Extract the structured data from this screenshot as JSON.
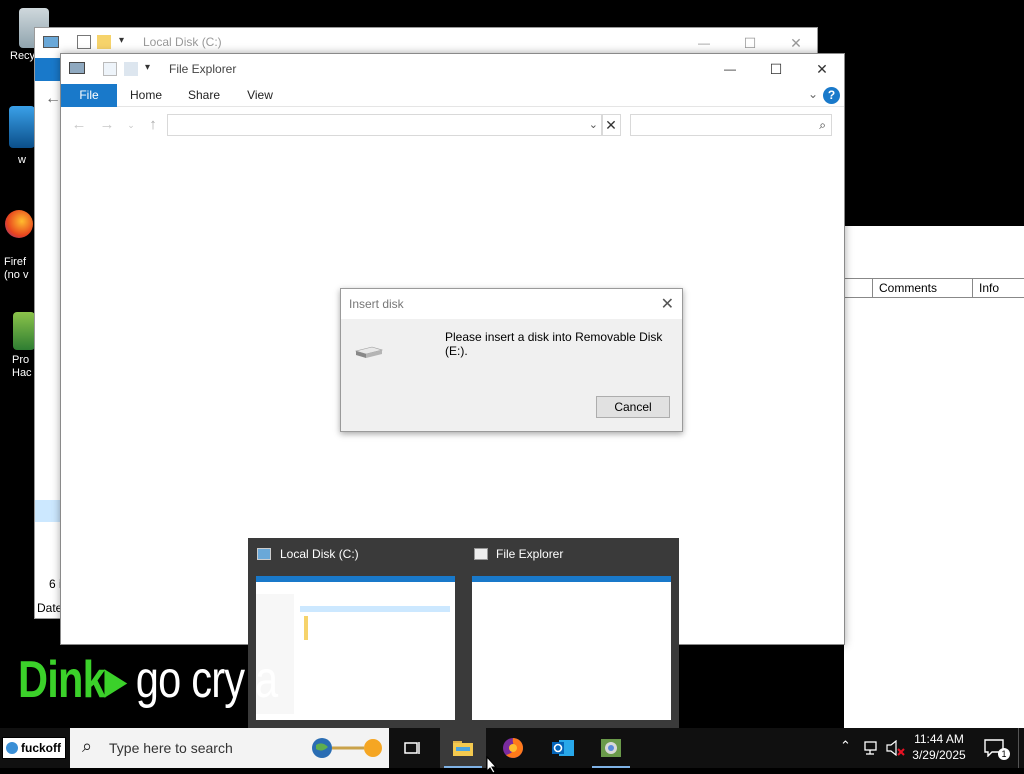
{
  "desktop": {
    "icons": [
      {
        "label": "Recy"
      },
      {
        "label": "w"
      },
      {
        "label": "Firef\n(no v"
      },
      {
        "label": "Pro\nHac"
      }
    ],
    "background_text": {
      "part1": "Dink",
      "arrow": "▸",
      "part2": " go cry a"
    }
  },
  "background_window": {
    "title": "Local Disk (C:)",
    "left_partial_labels": {
      "count": "6 i",
      "date": "Date"
    }
  },
  "background_right_table": {
    "columns": [
      "Comments",
      "Info"
    ]
  },
  "file_explorer": {
    "title": "File Explorer",
    "tabs": [
      "File",
      "Home",
      "Share",
      "View"
    ],
    "help_label": "?",
    "minimize_label": "—",
    "maximize_label": "☐",
    "close_label": "✕"
  },
  "dialog": {
    "title": "Insert disk",
    "message": "Please insert a disk into Removable Disk (E:).",
    "cancel_label": "Cancel"
  },
  "thumbnails": [
    {
      "title": "Local Disk (C:)"
    },
    {
      "title": "File Explorer"
    }
  ],
  "taskbar": {
    "start_label": "fuckoff",
    "search_placeholder": "Type here to search",
    "clock_time": "11:44 AM",
    "clock_date": "3/29/2025",
    "notification_count": "1"
  },
  "colors": {
    "accent": "#1979ca",
    "taskbar": "#101010",
    "dialog_bg": "#f0f0f0"
  }
}
